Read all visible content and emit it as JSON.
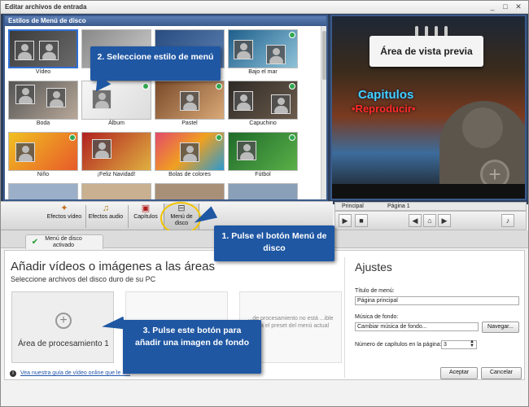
{
  "window": {
    "title": "Editar archivos de entrada",
    "controls": [
      "_",
      "□",
      "✕"
    ]
  },
  "styles_panel": {
    "header": "Estilos de Menú de disco",
    "items": [
      {
        "label": "Vídeo",
        "selected": true,
        "badge": false
      },
      {
        "label": "",
        "selected": false,
        "badge": false
      },
      {
        "label": "",
        "selected": false,
        "badge": false
      },
      {
        "label": "Bajo el mar",
        "selected": false,
        "badge": true
      },
      {
        "label": "Boda",
        "selected": false,
        "badge": false
      },
      {
        "label": "Álbum",
        "selected": false,
        "badge": true
      },
      {
        "label": "Pastel",
        "selected": false,
        "badge": true
      },
      {
        "label": "Capuchino",
        "selected": false,
        "badge": true
      },
      {
        "label": "Niño",
        "selected": false,
        "badge": true
      },
      {
        "label": "¡Feliz Navidad!",
        "selected": false,
        "badge": false
      },
      {
        "label": "Bolas de colores",
        "selected": false,
        "badge": true
      },
      {
        "label": "Fútbol",
        "selected": false,
        "badge": true
      }
    ]
  },
  "preview": {
    "note_text": "Área de vista previa",
    "caption_capitulos": "Capitulos",
    "caption_reproducir": "•Reproducir•",
    "tabs": [
      "Principal",
      "Página 1"
    ]
  },
  "toolbar": {
    "buttons": [
      {
        "label": "Efectos vídeo",
        "icon": "fx-icon"
      },
      {
        "label": "Efectos audio",
        "icon": "audio-fx-icon"
      },
      {
        "label": "Capítulos",
        "icon": "chapters-icon"
      },
      {
        "label": "Menú de disco",
        "icon": "disc-menu-icon"
      }
    ]
  },
  "bottom": {
    "tab_label": "Menú de disco activado",
    "heading": "Añadir vídeos o imágenes a las áreas",
    "subheading": "Seleccione archivos del disco duro de su PC",
    "area1_label": "Área de procesamiento 1",
    "area3_text": "...de procesamiento no está ...ible para el preset del menú actual",
    "guide_link": "Vea nuestra guía de vídeo online que le a..."
  },
  "settings": {
    "title": "Ajustes",
    "menu_title_label": "Título de menú:",
    "menu_title_value": "Página principal",
    "music_label": "Música de fondo:",
    "music_value": "Cambiar música de fondo...",
    "browse_button": "Navegar...",
    "chapters_label": "Número de capítulos en la página:",
    "chapters_value": "3"
  },
  "footer": {
    "accept": "Aceptar",
    "cancel": "Cancelar"
  },
  "callouts": {
    "step1": "1. Pulse el botón Menú de disco",
    "step2": "2. Seleccione estilo de menú",
    "step3": "3. Pulse este botón para añadir una imagen de fondo"
  },
  "colors": {
    "callout": "#1f57a3",
    "highlight_ring": "#f2c400",
    "badge": "#2fa84f",
    "panel_border": "#3a5a8c"
  }
}
